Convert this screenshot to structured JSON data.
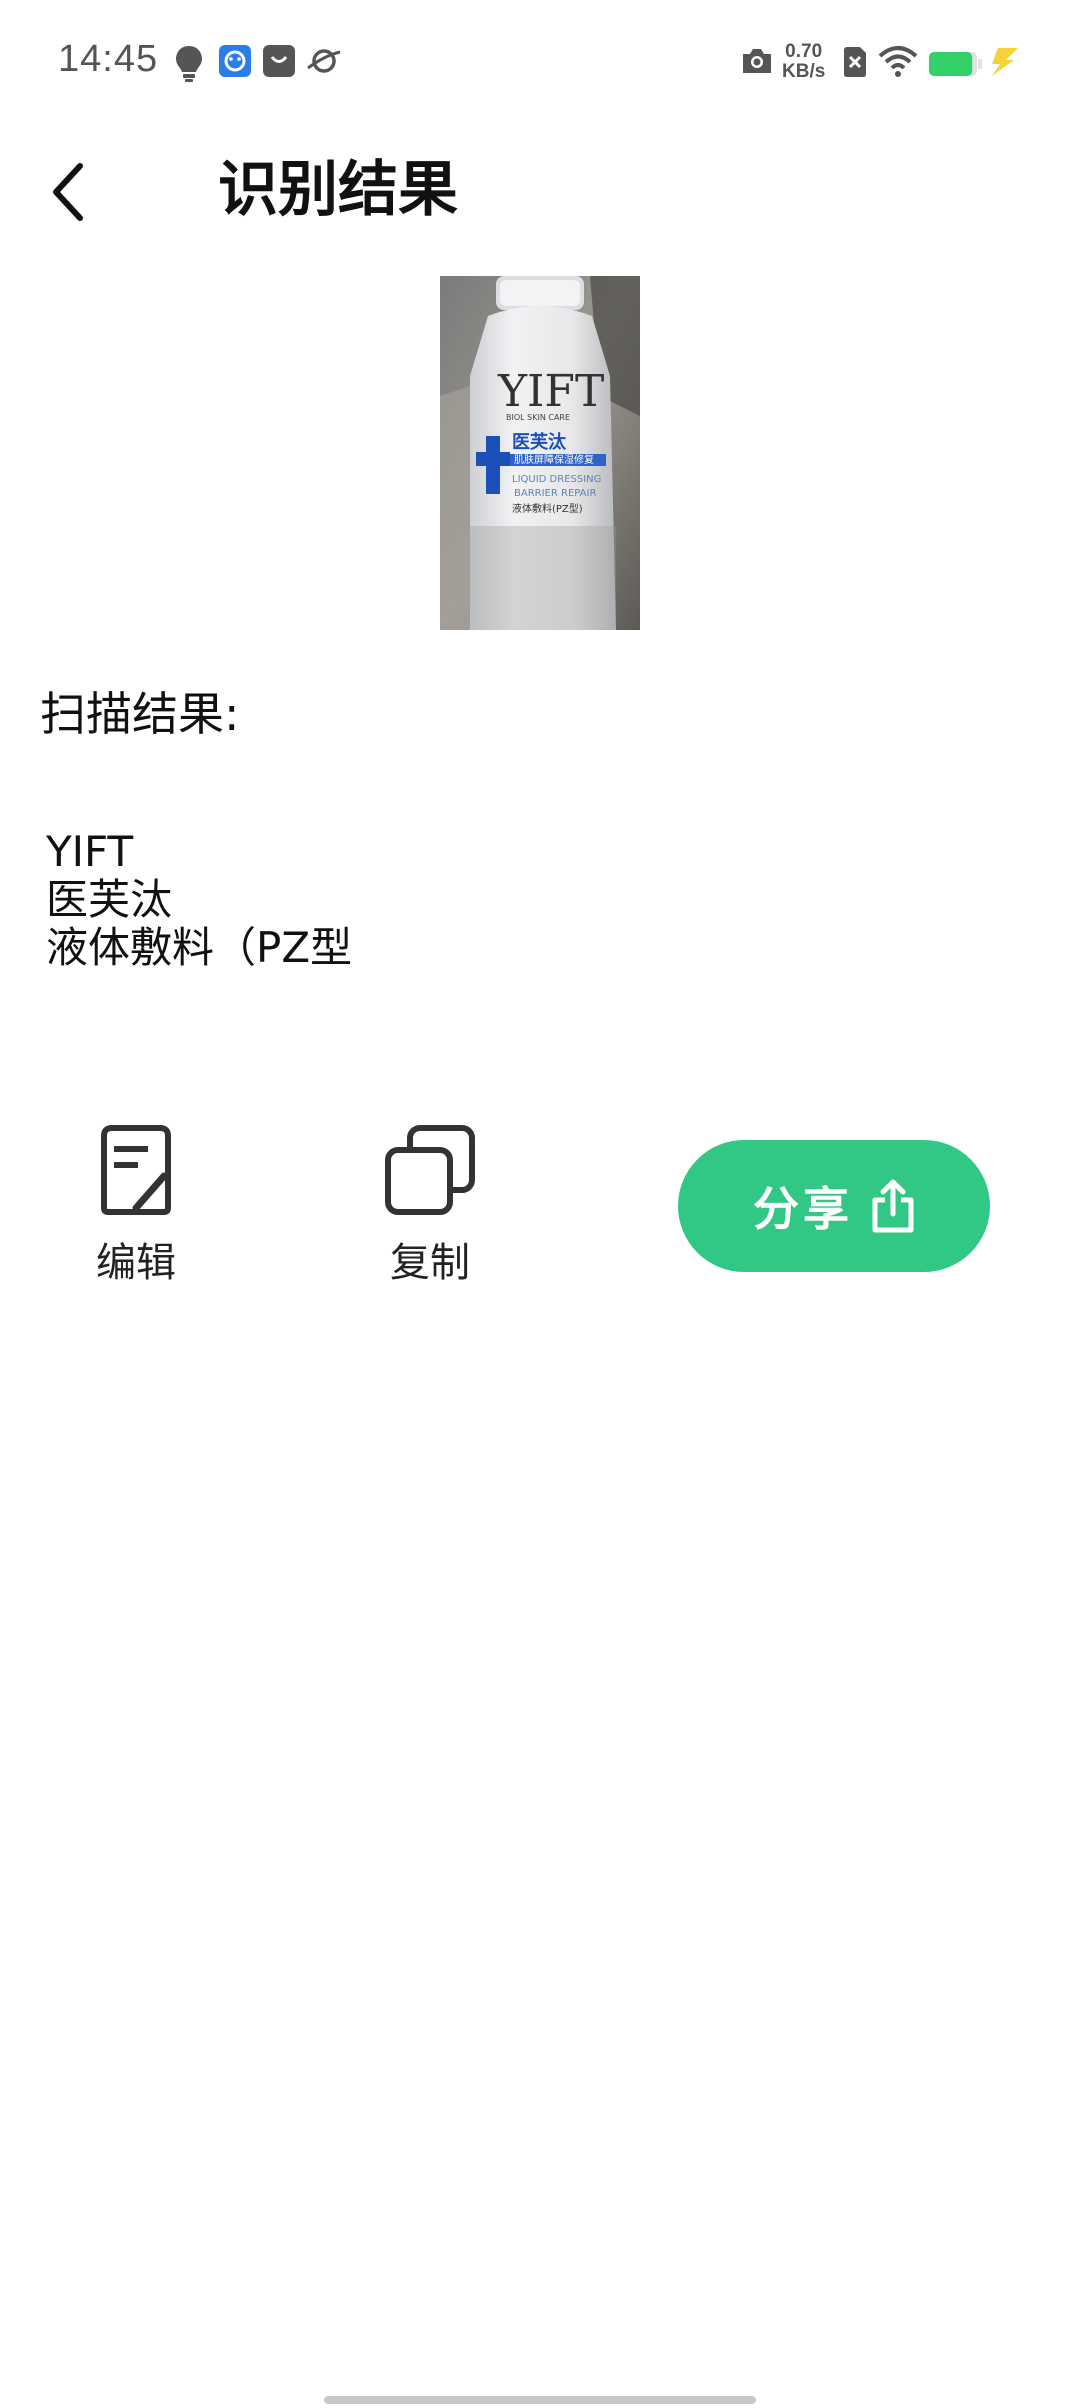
{
  "status_bar": {
    "time": "14:45",
    "net_speed_value": "0.70",
    "net_speed_unit": "KB/s",
    "battery_level": 0.9,
    "icons": [
      "bulb-icon",
      "face-app-icon",
      "shopping-bag-icon",
      "planet-icon",
      "camera-icon",
      "sim-x-icon",
      "wifi-icon",
      "battery-icon",
      "charging-bolt-icon"
    ]
  },
  "header": {
    "title": "识别结果",
    "back_icon": "chevron-left-icon"
  },
  "scan": {
    "image_alt": "photo-of-bottle",
    "bottle_brand": "YIFT",
    "bottle_subtitle": "BIOL SKIN CARE",
    "bottle_name": "医芙汰",
    "bottle_line1": "肌肤屏障保湿修复",
    "bottle_line2": "LIQUID DRESSING",
    "bottle_line3": "BARRIER REPAIR",
    "bottle_line4": "液体敷料(PZ型)"
  },
  "result": {
    "label": "扫描结果:",
    "lines": [
      "YIFT",
      "医芙汰",
      "液体敷料（PZ型"
    ]
  },
  "actions": {
    "edit_label": "编辑",
    "copy_label": "复制",
    "share_label": "分享"
  },
  "colors": {
    "accent": "#31c885",
    "text": "#111111",
    "battery": "#33d16a"
  }
}
